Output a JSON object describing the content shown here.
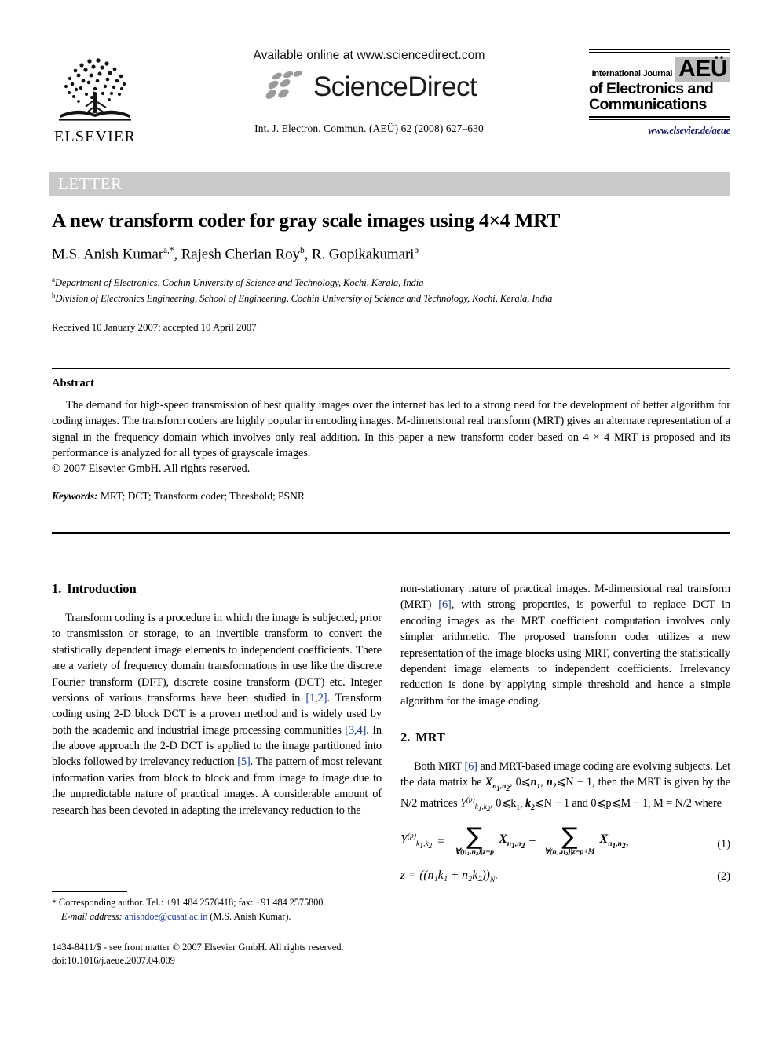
{
  "header": {
    "publisher_name": "ELSEVIER",
    "available_online": "Available online at www.sciencedirect.com",
    "sciencedirect_wordmark": "ScienceDirect",
    "citation_line": "Int. J. Electron. Commun. (AEÜ) 62 (2008) 627–630",
    "journal_logo": {
      "intl_journal": "International Journal",
      "aeu": "AEÜ",
      "line2": "of Electronics and",
      "line3": "Communications"
    },
    "journal_url": "www.elsevier.de/aeue",
    "url_color": "#16166b"
  },
  "banner": {
    "label": "LETTER",
    "background": "#c9c9c9",
    "text_color": "#ffffff"
  },
  "title_block": {
    "title": "A new transform coder for gray scale images using 4×4 MRT",
    "authors": [
      {
        "name": "M.S. Anish Kumar",
        "marks": "a,*"
      },
      {
        "name": "Rajesh Cherian Roy",
        "marks": "b"
      },
      {
        "name": "R. Gopikakumari",
        "marks": "b"
      }
    ],
    "authors_separator": ", ",
    "affiliations": [
      {
        "mark": "a",
        "text": "Department of Electronics, Cochin University of Science and Technology, Kochi, Kerala, India"
      },
      {
        "mark": "b",
        "text": "Division of Electronics Engineering, School of Engineering, Cochin University of Science and Technology, Kochi, Kerala, India"
      }
    ],
    "received": "Received 10 January 2007; accepted 10 April 2007"
  },
  "abstract": {
    "heading": "Abstract",
    "body": "The demand for high-speed transmission of best quality images over the internet has led to a strong need for the development of better algorithm for coding images. The transform coders are highly popular in encoding images. M-dimensional real transform (MRT) gives an alternate representation of a signal in the frequency domain which involves only real addition. In this paper a new transform coder based on 4 × 4 MRT is proposed and its performance is analyzed for all types of grayscale images.",
    "copyright": "© 2007 Elsevier GmbH. All rights reserved.",
    "keywords_label": "Keywords:",
    "keywords_value": "MRT; DCT; Transform coder; Threshold; PSNR"
  },
  "sections": {
    "introduction": {
      "number": "1.",
      "title": "Introduction",
      "para_part1": "Transform coding is a procedure in which the image is subjected, prior to transmission or storage, to an invertible transform to convert the statistically dependent image elements to independent coefficients. There are a variety of frequency domain transformations in use like the discrete Fourier transform (DFT), discrete cosine transform (DCT) etc. Integer versions of various transforms have been studied in ",
      "ref1": "[1,2]",
      "para_part2": ". Transform coding using 2-D block DCT is a proven method and is widely used by both the academic and industrial image processing communities ",
      "ref2": "[3,4]",
      "para_part3": ". In the above approach the 2-D DCT is applied to the image partitioned into blocks followed by irrelevancy reduction ",
      "ref3": "[5]",
      "para_part4": ". The pattern of most relevant information varies from block to block and from image to image due to the unpredictable nature of practical images. A considerable amount of research has been devoted in adapting the irrelevancy reduction to the ",
      "para_part5_right": "non-stationary nature of practical images. M-dimensional real transform (MRT) ",
      "ref4": "[6]",
      "para_part6_right": ", with strong properties, is powerful to replace DCT in encoding images as the MRT coefficient computation involves only simpler arithmetic. The proposed transform coder utilizes a new representation of the image blocks using MRT, converting the statistically dependent image elements to independent coefficients. Irrelevancy reduction is done by applying simple threshold and hence a simple algorithm for the image coding."
    },
    "mrt": {
      "number": "2.",
      "title": "MRT",
      "para_part1": "Both MRT ",
      "ref1": "[6]",
      "para_part2": " and MRT-based image coding are evolving subjects. Let the data matrix be ",
      "para_part3": ", 0⩽",
      "para_part4": ", ",
      "para_part5": "⩽N − 1, then the MRT is given by the N/2 matrices ",
      "para_part6": ", 0⩽k",
      "para_part7": "⩽N − 1 and 0⩽p⩽M − 1, M = N/2 where"
    }
  },
  "equations": {
    "eq1": {
      "number": "(1)",
      "lhs": "Y",
      "lhs_sup": "(p)",
      "lhs_sub": "k₁,k₂",
      "equals": "=",
      "sum1_symbol": "∑",
      "sum1_limit": "∀(n₁,n₂)|z=p",
      "term1": "X",
      "term1_sub": "n₁,n₂",
      "minus": "−",
      "sum2_symbol": "∑",
      "sum2_limit": "∀(n₁,n₂)|z=p+M",
      "term2": "X",
      "term2_sub": "n₁,n₂",
      "trailing_comma": ","
    },
    "eq2": {
      "number": "(2)",
      "text": "z = ((n₁k₁ + n₂k₂))",
      "sub": "N",
      "period": "."
    }
  },
  "footnote": {
    "star": "*",
    "corresponding": "Corresponding author. Tel.: +91 484 2576418; fax: +91 484 2575800.",
    "email_label": "E-mail address:",
    "email": "anishdoe@cusat.ac.in",
    "email_owner": "(M.S. Anish Kumar).",
    "email_color": "#1a3a9b"
  },
  "frontmatter": {
    "line1": "1434-8411/$ - see front matter © 2007 Elsevier GmbH. All rights reserved.",
    "line2": "doi:10.1016/j.aeue.2007.04.009"
  }
}
